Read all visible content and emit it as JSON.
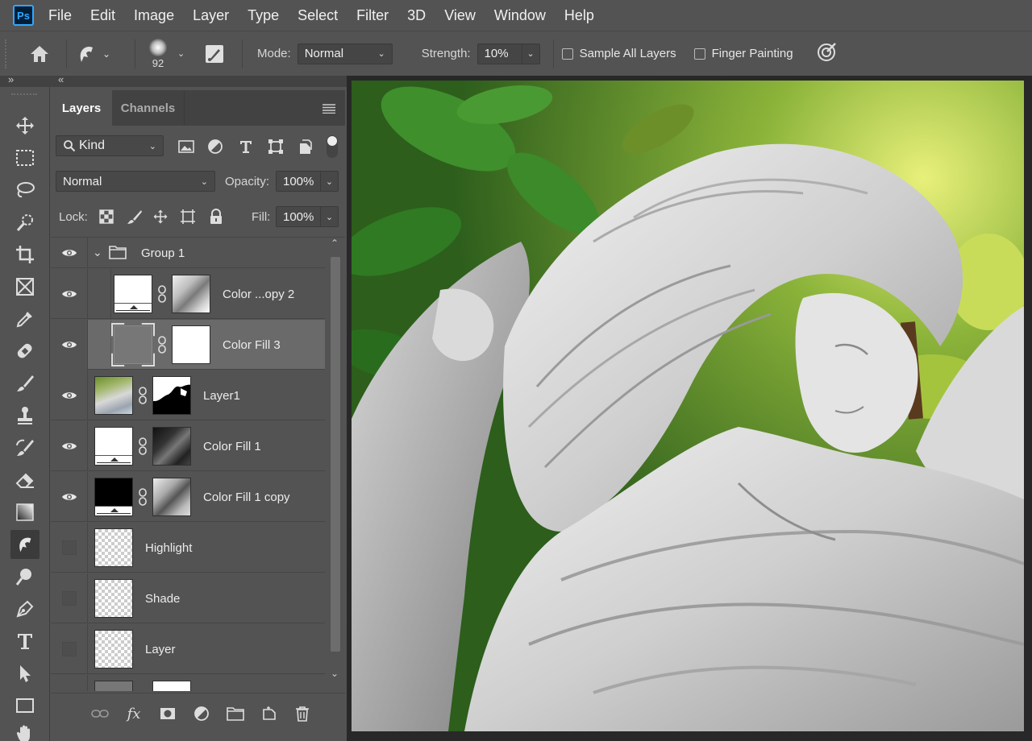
{
  "app": {
    "logo": "Ps"
  },
  "menu": [
    "File",
    "Edit",
    "Image",
    "Layer",
    "Type",
    "Select",
    "Filter",
    "3D",
    "View",
    "Window",
    "Help"
  ],
  "options": {
    "brush_size": "92",
    "mode_label": "Mode:",
    "mode_value": "Normal",
    "strength_label": "Strength:",
    "strength_value": "10%",
    "sample_all_layers_label": "Sample All Layers",
    "sample_all_layers_checked": false,
    "finger_painting_label": "Finger Painting",
    "finger_painting_checked": false
  },
  "panel_collapse": {
    "left": "»",
    "right": "«"
  },
  "tools": [
    {
      "name": "move-icon"
    },
    {
      "name": "marquee-icon"
    },
    {
      "name": "lasso-icon"
    },
    {
      "name": "quick-select-icon"
    },
    {
      "name": "crop-icon"
    },
    {
      "name": "frame-icon"
    },
    {
      "name": "eyedropper-icon"
    },
    {
      "name": "healing-brush-icon"
    },
    {
      "name": "brush-icon"
    },
    {
      "name": "clone-stamp-icon"
    },
    {
      "name": "history-brush-icon"
    },
    {
      "name": "eraser-icon"
    },
    {
      "name": "gradient-icon"
    },
    {
      "name": "smudge-icon",
      "active": true
    },
    {
      "name": "dodge-icon"
    },
    {
      "name": "pen-icon"
    },
    {
      "name": "type-icon"
    },
    {
      "name": "path-select-icon"
    },
    {
      "name": "rectangle-icon"
    },
    {
      "name": "hand-icon"
    }
  ],
  "layers_panel": {
    "tabs": [
      "Layers",
      "Channels"
    ],
    "active_tab": "Layers",
    "filter_kind": "Kind",
    "blend_mode": "Normal",
    "opacity_label": "Opacity:",
    "opacity_value": "100%",
    "lock_label": "Lock:",
    "fill_label": "Fill:",
    "fill_value": "100%",
    "group_name": "Group 1",
    "layers": [
      {
        "name": "Color ...opy 2",
        "visible": true,
        "indented": true,
        "thumb": "white-fill",
        "mask": "statue-mask"
      },
      {
        "name": "Color Fill 3",
        "visible": true,
        "indented": true,
        "selected": true,
        "thumb": "gray-fill",
        "mask": "white"
      },
      {
        "name": "Layer1",
        "visible": true,
        "indented": false,
        "thumb": "photo",
        "mask": "black-mask"
      },
      {
        "name": "Color Fill 1",
        "visible": true,
        "indented": false,
        "thumb": "white-fill",
        "mask": "dark-statue-mask"
      },
      {
        "name": "Color Fill 1 copy",
        "visible": true,
        "indented": false,
        "thumb": "black-fill",
        "mask": "statue-mask"
      },
      {
        "name": "Highlight",
        "visible": false,
        "indented": false,
        "thumb": "transparent"
      },
      {
        "name": "Shade",
        "visible": false,
        "indented": false,
        "thumb": "transparent"
      },
      {
        "name": "Layer",
        "visible": false,
        "indented": false,
        "thumb": "transparent"
      }
    ],
    "bottom_buttons": [
      "link-icon",
      "fx-icon",
      "mask-icon",
      "adjustment-icon",
      "folder-icon",
      "new-layer-icon",
      "trash-icon"
    ],
    "fx_label": "fx"
  },
  "colors": {
    "ui_bg": "#535353",
    "tab_bg": "#424242",
    "canvas_bg": "#282828",
    "selected_layer": "#6a6a6a",
    "ps_blue": "#31a8ff"
  }
}
